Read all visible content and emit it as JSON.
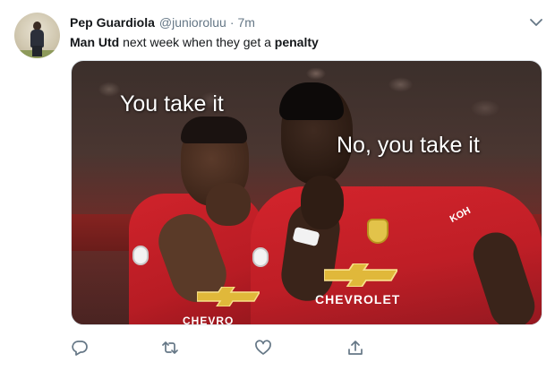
{
  "tweet": {
    "author_name": "Pep Guardiola",
    "handle": "@junioroluu",
    "separator": "·",
    "time": "7m",
    "text_bold_1": "Man Utd",
    "text_mid": " next week when they get a ",
    "text_bold_2": "penalty"
  },
  "media": {
    "caption_left": "You take it",
    "caption_right": "No, you take it",
    "sponsor_left": "CHEVRO",
    "sponsor_right": "CHEVROLET",
    "kit_maker": "KOH"
  },
  "icons": {
    "menu": "chevron-down-icon",
    "reply": "reply-icon",
    "retweet": "retweet-icon",
    "like": "heart-icon",
    "share": "share-icon"
  },
  "colors": {
    "text_primary": "#14171a",
    "text_secondary": "#657786",
    "icon_gray": "#657786",
    "kit_red": "#c8202a"
  }
}
